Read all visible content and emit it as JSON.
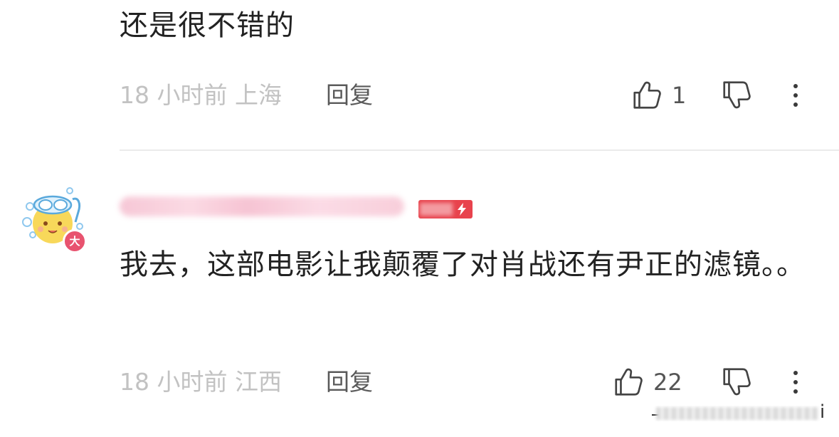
{
  "comments": [
    {
      "text": "还是很不错的",
      "time": "18 小时前",
      "location": "上海",
      "reply_label": "回复",
      "like_count": "1"
    },
    {
      "avatar_badge": "大",
      "text": "我去，这部电影让我颠覆了对肖战还有尹正的滤镜。。",
      "time": "18 小时前",
      "location": "江西",
      "reply_label": "回复",
      "like_count": "22"
    }
  ],
  "partial_edge_text": "i",
  "colors": {
    "meta_gray": "#c2c2c2",
    "text": "#222222",
    "level_badge": "#e8434d",
    "avatar_badge": "#e8536f",
    "username_blur": "#f6c5d4"
  },
  "icons": [
    "thumbs-up-icon",
    "thumbs-down-icon",
    "more-vertical-icon",
    "lightning-icon"
  ]
}
